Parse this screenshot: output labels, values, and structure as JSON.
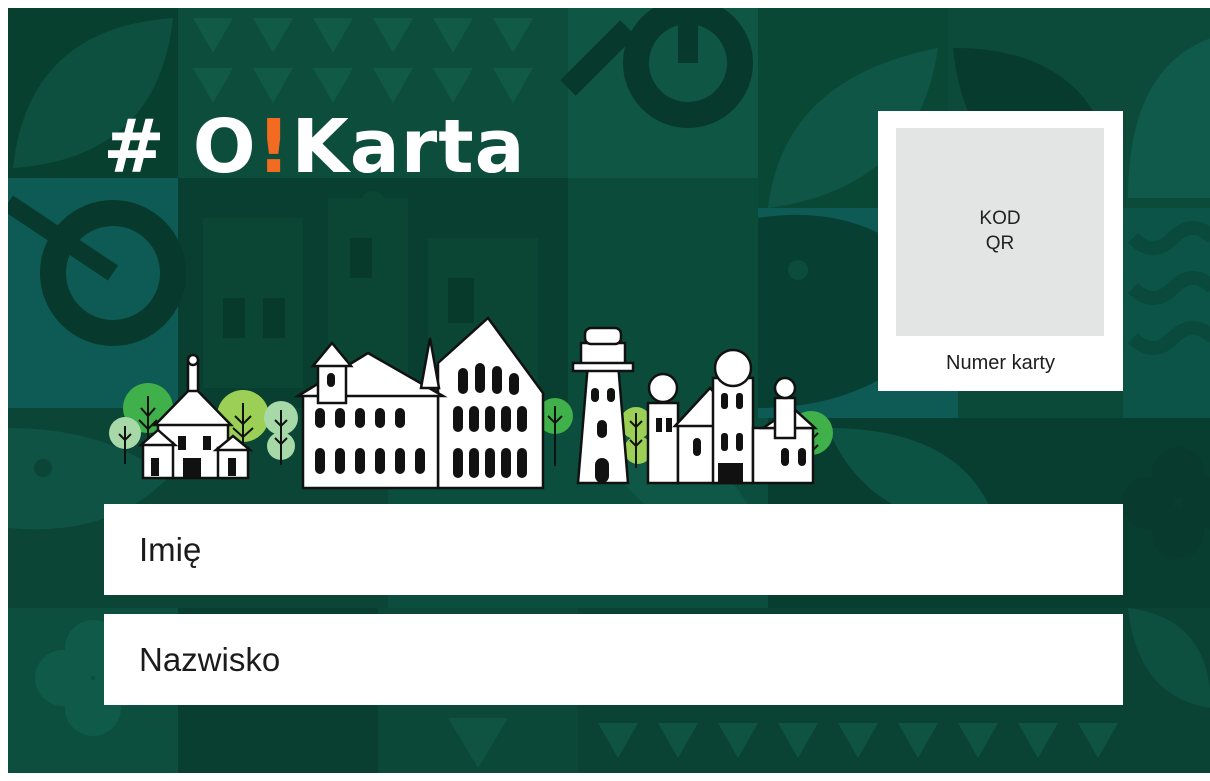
{
  "card": {
    "logo": {
      "hash": "#",
      "o": "O",
      "bang": "!",
      "rest": "Karta"
    },
    "qr": {
      "line1": "KOD",
      "line2": "QR",
      "number_label": "Numer karty"
    },
    "fields": {
      "first_name": "Imię",
      "last_name": "Nazwisko"
    }
  },
  "colors": {
    "background": "#0b4a39",
    "dark_green": "#063b2c",
    "teal": "#0e5b55",
    "accent_orange": "#f26b21",
    "tree_green": "#3fb04a",
    "tree_light": "#9ccf55",
    "white": "#ffffff",
    "qr_placeholder": "#e3e5e4"
  },
  "icons": [
    "bicycle-icon",
    "clock-icon",
    "leaf-icon",
    "fish-icon",
    "flower-icon",
    "wave-icon",
    "tree-icon"
  ]
}
